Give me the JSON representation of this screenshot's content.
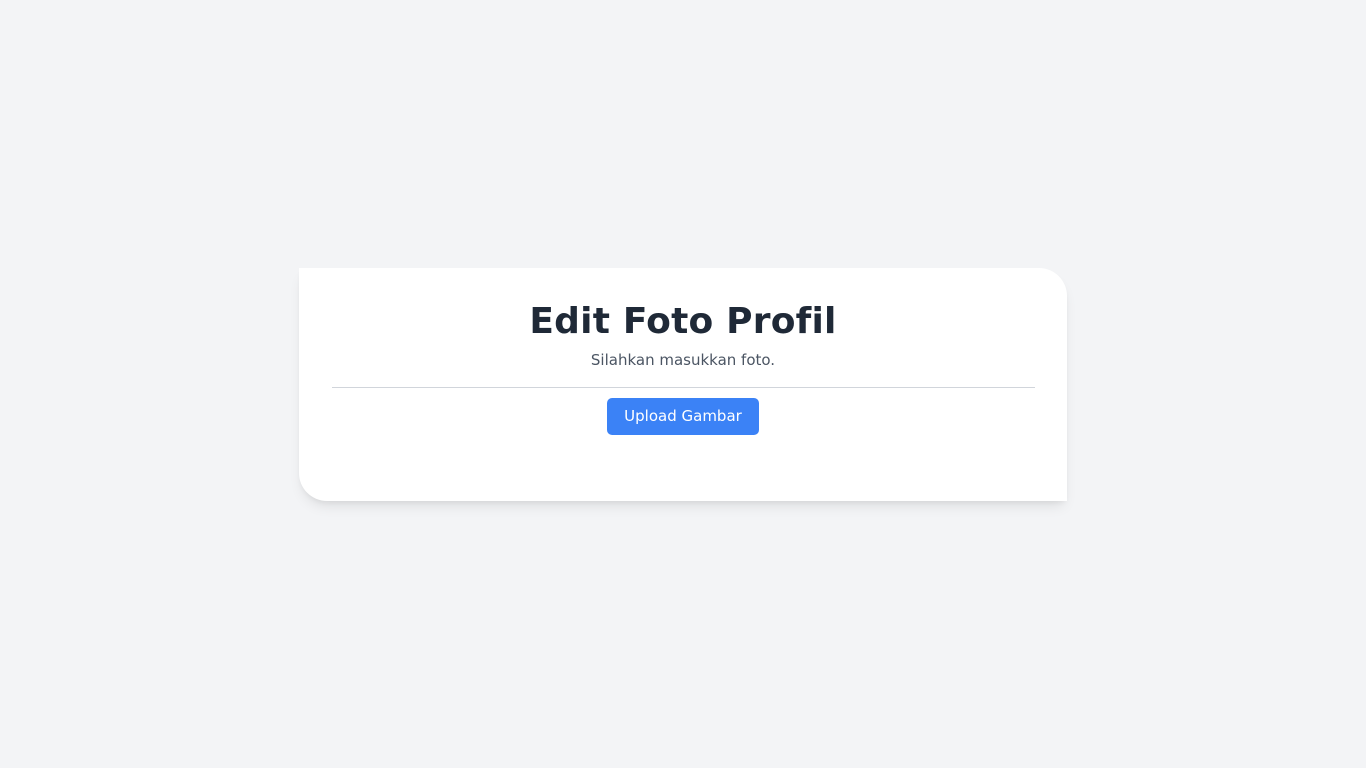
{
  "card": {
    "title": "Edit Foto Profil",
    "subtitle": "Silahkan masukkan foto.",
    "upload_label": "Upload Gambar"
  },
  "colors": {
    "background": "#f3f4f6",
    "card": "#ffffff",
    "title": "#1f2937",
    "subtitle": "#4b5563",
    "divider": "#d1d5db",
    "button": "#3b82f6",
    "button_text": "#ffffff"
  }
}
